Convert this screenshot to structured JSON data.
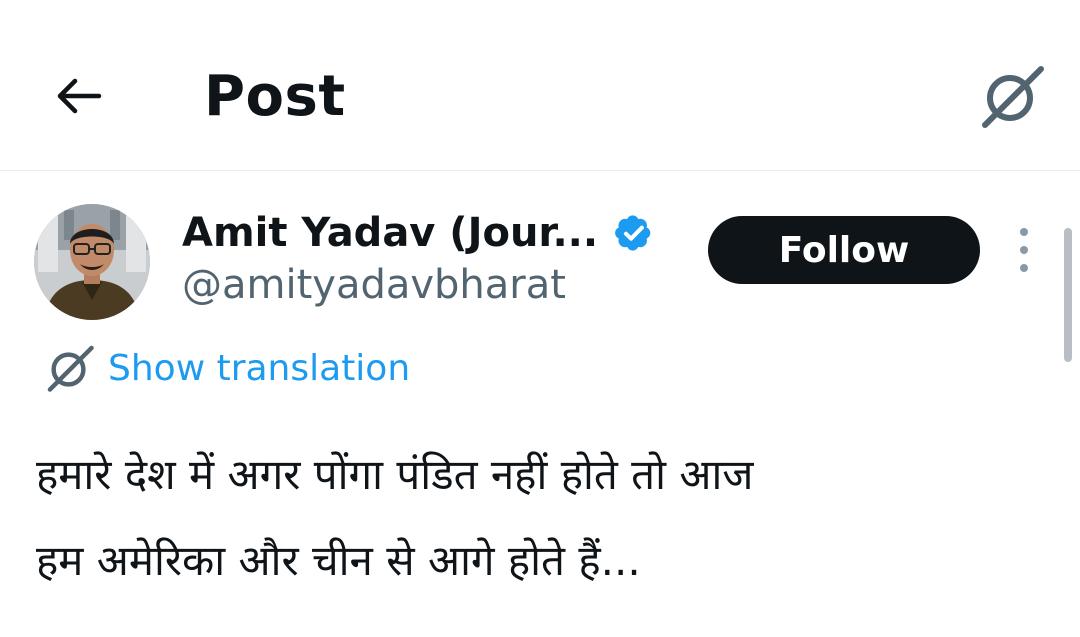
{
  "header": {
    "title": "Post",
    "back_icon": "arrow-left-icon",
    "grok_icon": "grok-icon"
  },
  "author": {
    "display_name": "Amit Yadav (Jour...",
    "handle": "@amityadavbharat",
    "verified": true,
    "verified_color": "#1d9bf0"
  },
  "actions": {
    "follow_label": "Follow",
    "more_icon": "more-vertical-icon"
  },
  "translation": {
    "label": "Show translation",
    "color": "#1d9bf0"
  },
  "post": {
    "text_line1": "हमारे देश में अगर पोंगा पंडित नहीं होते तो आज",
    "text_line2": "हम अमेरिका और चीन से आगे होते हैं..."
  }
}
